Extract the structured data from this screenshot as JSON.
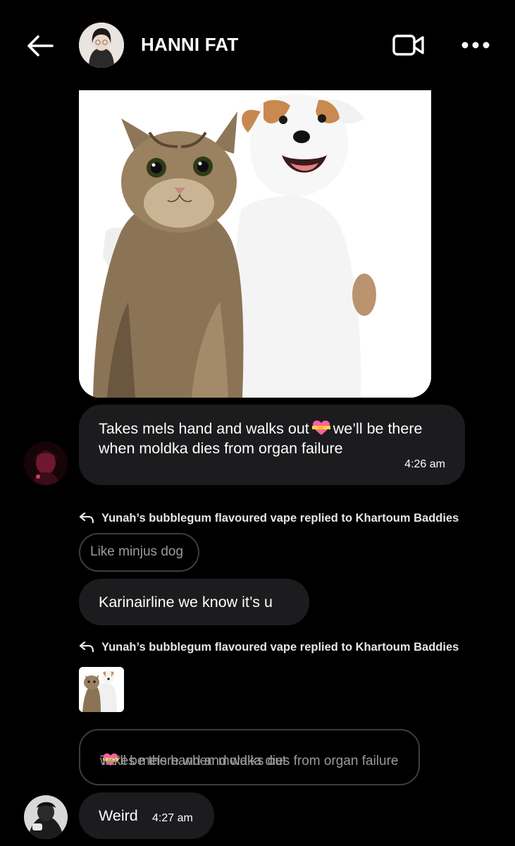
{
  "header": {
    "title": "HANNI FAT",
    "back_icon": "arrow-left-icon",
    "video_icon": "video-camera-icon",
    "more_icon": "more-horizontal-icon"
  },
  "messages": [
    {
      "type": "image",
      "description_icon": "cat-and-dog-photo"
    },
    {
      "type": "text",
      "text_before": "Takes mels hand and walks out",
      "emoji": "heart-with-ribbon-emoji",
      "text_after": "we’ll be there when moldka dies from organ failure",
      "time": "4:26 am"
    }
  ],
  "reply1": {
    "label": "Yunah’s bubblegum flavoured vape replied to Khartoum Baddies",
    "quoted": "Like minjus dog",
    "message": "Karinairline we know it’s u"
  },
  "reply2": {
    "label": "Yunah’s bubblegum flavoured vape replied to Khartoum Baddies",
    "quoted_before": "Takes mels hand and walks out",
    "quoted_after": "we’ll be there when moldka dies from organ failure",
    "message": "Weird",
    "time": "4:27 am"
  },
  "colors": {
    "background": "#000000",
    "bubble": "#1c1c1e",
    "quote_border": "#3d3d3f",
    "quote_text": "#9a9a9e"
  }
}
